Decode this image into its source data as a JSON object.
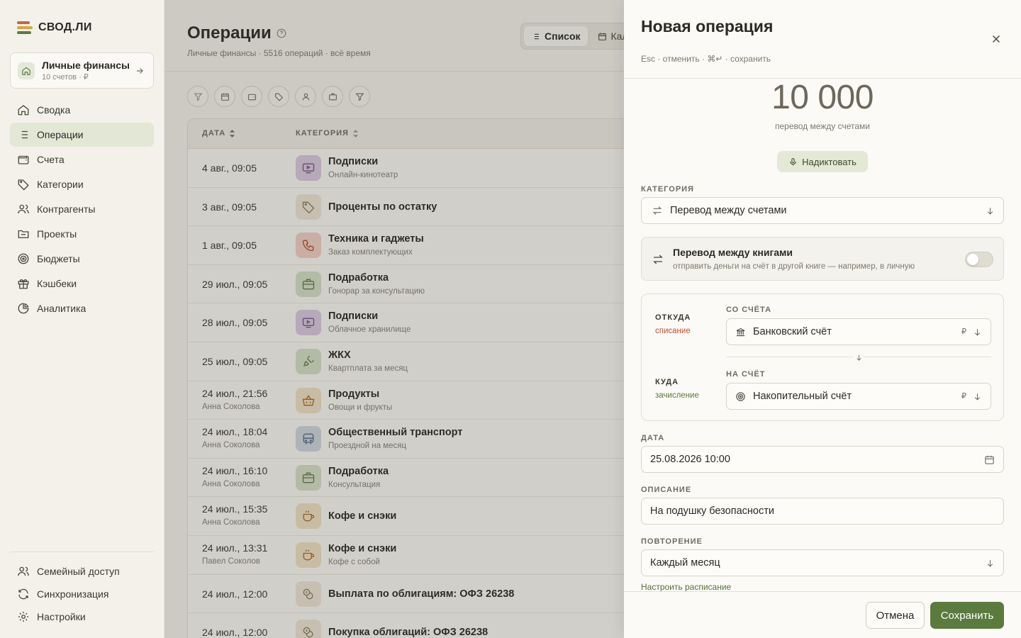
{
  "app": {
    "name": "СВОД.ЛИ"
  },
  "book": {
    "title": "Личные финансы",
    "subtitle": "10 счетов · ₽"
  },
  "sidebar": {
    "items": [
      {
        "label": "Сводка",
        "icon": "home-icon",
        "active": false
      },
      {
        "label": "Операции",
        "icon": "list-icon",
        "active": true
      },
      {
        "label": "Счета",
        "icon": "wallet-icon",
        "active": false
      },
      {
        "label": "Категории",
        "icon": "tag-icon",
        "active": false
      },
      {
        "label": "Контрагенты",
        "icon": "users-icon",
        "active": false
      },
      {
        "label": "Проекты",
        "icon": "folder-icon",
        "active": false
      },
      {
        "label": "Бюджеты",
        "icon": "target-icon",
        "active": false
      },
      {
        "label": "Кэшбеки",
        "icon": "gift-icon",
        "active": false
      },
      {
        "label": "Аналитика",
        "icon": "pie-chart-icon",
        "active": false
      }
    ],
    "bottom": [
      {
        "label": "Семейный доступ",
        "icon": "family-icon"
      },
      {
        "label": "Синхронизация",
        "icon": "sync-icon"
      },
      {
        "label": "Настройки",
        "icon": "gear-icon"
      }
    ]
  },
  "main": {
    "title": "Операции",
    "subtitle": "Личные финансы · 5516 операций · всё время",
    "tabs": [
      {
        "label": "Список",
        "active": true
      },
      {
        "label": "Календарь",
        "active": false
      }
    ],
    "table": {
      "headers": {
        "date": "ДАТА",
        "category": "КАТЕГОРИЯ"
      },
      "rows": [
        {
          "date": "4 авг., 09:05",
          "user": "",
          "category": "Подписки",
          "note": "Онлайн-кинотеатр",
          "icon": "tv-icon",
          "color": "#d9c9e0"
        },
        {
          "date": "3 авг., 09:05",
          "user": "",
          "category": "Проценты по остатку",
          "note": "",
          "icon": "tag-icon",
          "color": "#efe6d8"
        },
        {
          "date": "1 авг., 09:05",
          "user": "",
          "category": "Техника и гаджеты",
          "note": "Заказ комплектующих",
          "icon": "phone-icon",
          "color": "#f2d0c6"
        },
        {
          "date": "29 июл., 09:05",
          "user": "",
          "category": "Подработка",
          "note": "Гонорар за консультацию",
          "icon": "briefcase-icon",
          "color": "#d5dfc8"
        },
        {
          "date": "28 июл., 09:05",
          "user": "",
          "category": "Подписки",
          "note": "Облачное хранилище",
          "icon": "tv-icon",
          "color": "#d9c9e0"
        },
        {
          "date": "25 июл., 09:05",
          "user": "",
          "category": "ЖКХ",
          "note": "Квартплата за месяц",
          "icon": "plug-icon",
          "color": "#d5dfc8"
        },
        {
          "date": "24 июл., 21:56",
          "user": "Анна Соколова",
          "category": "Продукты",
          "note": "Овощи и фрукты",
          "icon": "basket-icon",
          "color": "#f1e2c6"
        },
        {
          "date": "24 июл., 18:04",
          "user": "Анна Соколова",
          "category": "Общественный транспорт",
          "note": "Проездной на месяц",
          "icon": "bus-icon",
          "color": "#cfd7df"
        },
        {
          "date": "24 июл., 16:10",
          "user": "Анна Соколова",
          "category": "Подработка",
          "note": "Консультация",
          "icon": "briefcase-icon",
          "color": "#d5dfc8"
        },
        {
          "date": "24 июл., 15:35",
          "user": "Анна Соколова",
          "category": "Кофе и снэки",
          "note": "",
          "icon": "coffee-icon",
          "color": "#f1e2c6"
        },
        {
          "date": "24 июл., 13:31",
          "user": "Павел Соколов",
          "category": "Кофе и снэки",
          "note": "Кофе с собой",
          "icon": "coffee-icon",
          "color": "#f1e2c6"
        },
        {
          "date": "24 июл., 12:00",
          "user": "",
          "category": "Выплата по облигациям: ОФЗ 26238",
          "note": "",
          "icon": "coins-icon",
          "color": "#efe6d8"
        },
        {
          "date": "24 июл., 12:00",
          "user": "",
          "category": "Покупка облигаций: ОФЗ 26238",
          "note": "",
          "icon": "coins-icon",
          "color": "#efe6d8"
        }
      ]
    }
  },
  "drawer": {
    "title": "Новая операция",
    "hint": "Esc · отменить · ⌘↵ · сохранить",
    "amount": "10 000",
    "amount_sub": "перевод между счетами",
    "dictate_label": "Надиктовать",
    "category_label": "КАТЕГОРИЯ",
    "category_value": "Перевод между счетами",
    "book_transfer": {
      "title": "Перевод между книгами",
      "subtitle": "отправить деньги на счёт в другой книге — например, в личную",
      "enabled": false
    },
    "from": {
      "dir": "ОТКУДА",
      "dir_sub": "списание",
      "label": "СО СЧЁТА",
      "account": "Банковский счёт",
      "currency": "₽"
    },
    "to": {
      "dir": "КУДА",
      "dir_sub": "зачисление",
      "label": "НА СЧЁТ",
      "account": "Накопительный счёт",
      "currency": "₽"
    },
    "date_label": "ДАТА",
    "date_value": "25.08.2026 10:00",
    "description_label": "ОПИСАНИЕ",
    "description_value": "На подушку безопасности",
    "repeat_label": "ПОВТОРЕНИЕ",
    "repeat_value": "Каждый месяц",
    "schedule_link": "Настроить расписание",
    "cancel_label": "Отмена",
    "save_label": "Сохранить"
  },
  "colors": {
    "accent": "#5b7a3e",
    "debit": "#c0512f",
    "credit": "#5b7a3e"
  }
}
